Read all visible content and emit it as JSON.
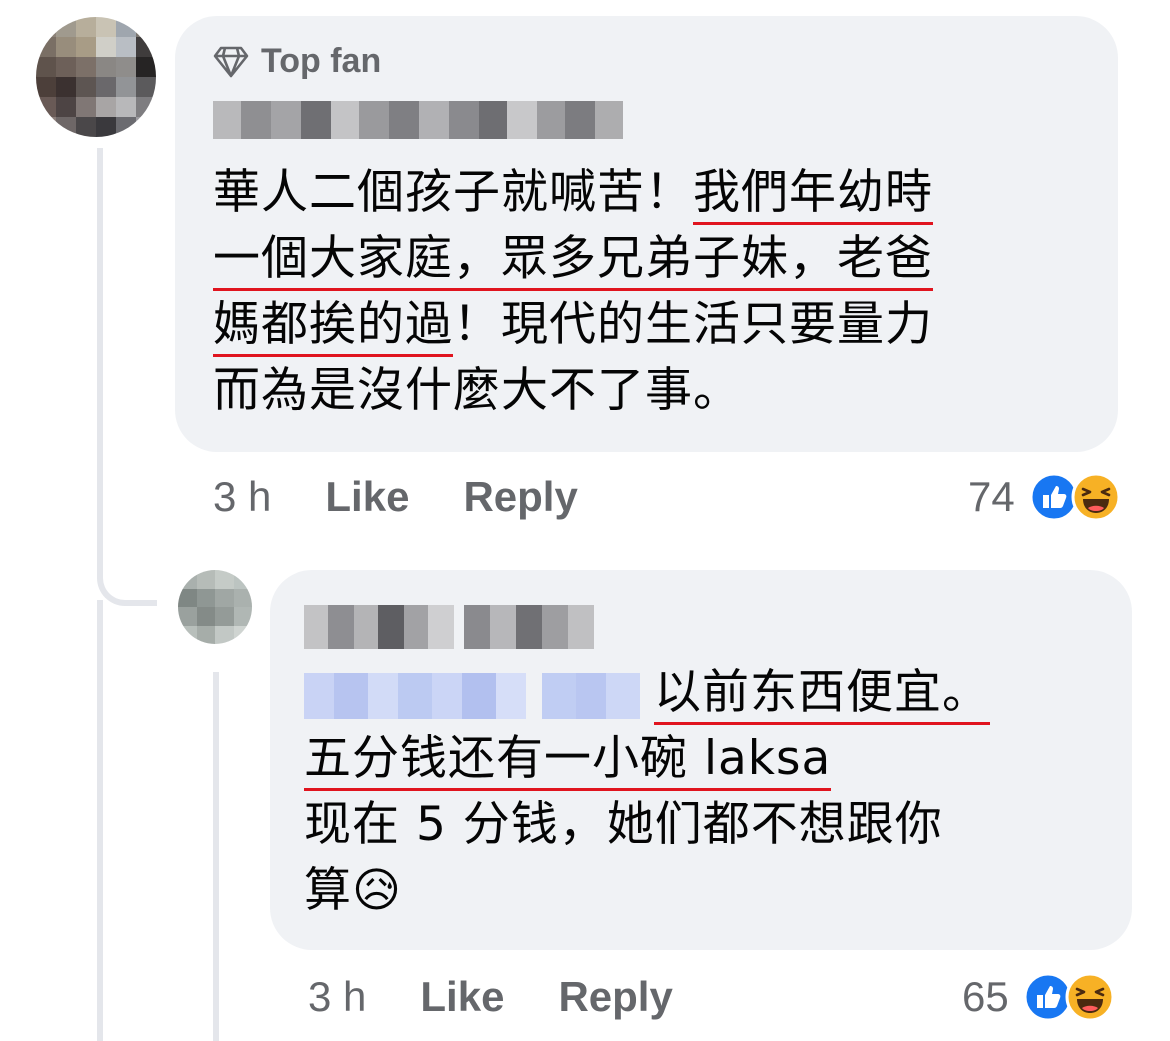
{
  "comments": [
    {
      "badge": "Top fan",
      "lines": [
        "華人二個孩子就喊苦！",
        "我們年幼時",
        "一個大家庭，眾多兄弟子妹，老爸",
        "媽都挨的過",
        "！現代的生活只要量力",
        "而為是沒什麼大不了事。"
      ],
      "time": "3 h",
      "like": "Like",
      "reply": "Reply",
      "reaction_count": "74",
      "reactions": [
        "like-icon",
        "haha-icon"
      ]
    },
    {
      "lines": [
        "以前东西便宜。",
        "五分钱还有一小碗 laksa",
        "现在 5 分钱，她们都不想跟你",
        "算",
        "😥"
      ],
      "time": "3 h",
      "like": "Like",
      "reply": "Reply",
      "reaction_count": "65",
      "reactions": [
        "like-icon",
        "haha-icon"
      ]
    }
  ],
  "colors": {
    "bubble": "#f0f2f5",
    "meta_text": "#65676b",
    "underline": "#e0141e",
    "like_blue": "#1877f2",
    "haha_yellow": "#f7b125"
  }
}
